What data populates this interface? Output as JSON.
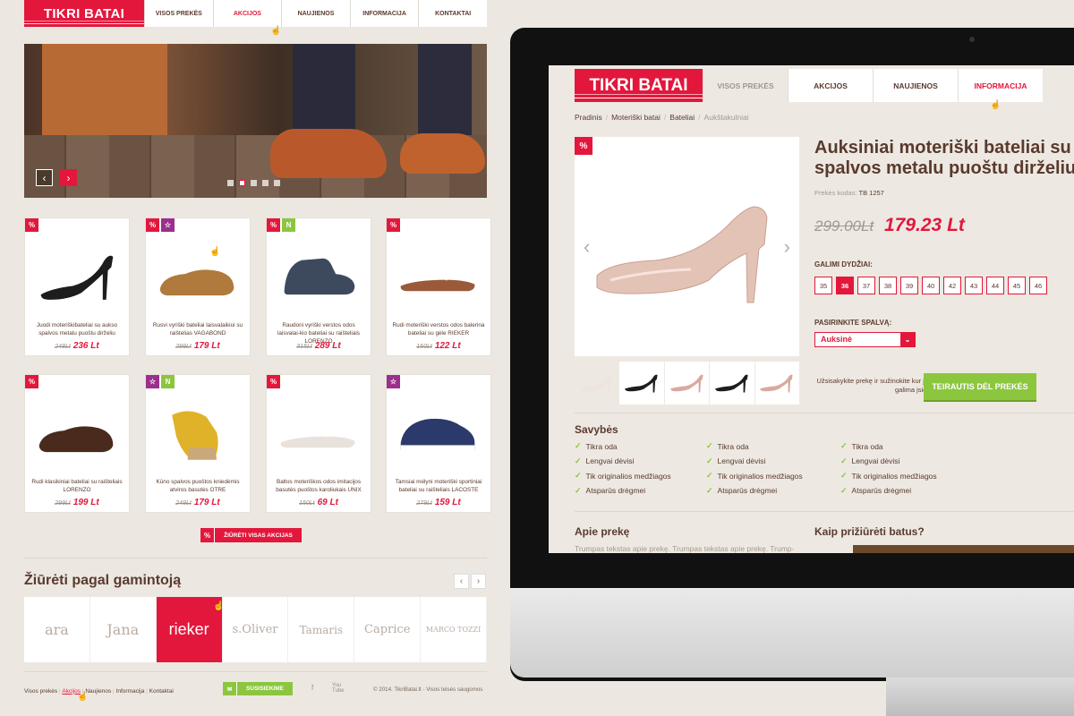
{
  "left": {
    "logo": "TIKRI BATAI",
    "nav": [
      "VISOS PREKĖS",
      "AKCIJOS",
      "NAUJIENOS",
      "INFORMACIJA",
      "KONTAKTAI"
    ],
    "nav_active": 1,
    "products": [
      {
        "badges": [
          "%"
        ],
        "name": "Juodi moteriškibateliai su aukso spalvos metalu puoštu dirželiu",
        "old": "248Lt",
        "new": "236 Lt",
        "color": "#1d1d1d",
        "kind": "heel"
      },
      {
        "badges": [
          "%",
          "☆"
        ],
        "name": "Rusvi vyriški bateliai laisvalaikiui su raištelias VAGABOND",
        "old": "299Lt",
        "new": "179 Lt",
        "color": "#b07a3c",
        "kind": "flat"
      },
      {
        "badges": [
          "%",
          "N"
        ],
        "name": "Raudoni vyriški verstos odos laisvalai-kio bateliai su raišteliais LORENZO",
        "old": "315Lt",
        "new": "289 Lt",
        "color": "#3d4a5e",
        "kind": "boot"
      },
      {
        "badges": [
          "%"
        ],
        "name": "Rudi moteriški verstos odos balerina bateliai su gėle RIEKER",
        "old": "150Lt",
        "new": "122 Lt",
        "color": "#9a5a3a",
        "kind": "sandal"
      },
      {
        "badges": [
          "%"
        ],
        "name": "Rudi klasikiniai bateliai su raišteliais LORENZO",
        "old": "299Lt",
        "new": "199 Lt",
        "color": "#4a2a1c",
        "kind": "flat"
      },
      {
        "badges": [
          "☆",
          "N"
        ],
        "name": "Kūno spalvos puoštos kniedėmis atviros basutės OTRE",
        "old": "249Lt",
        "new": "179 Lt",
        "color": "#e0b22a",
        "kind": "wedge"
      },
      {
        "badges": [
          "%"
        ],
        "name": "Baltos moteriškos odos imitacijos basutės puoštos karoliukais UNIX",
        "old": "150Lt",
        "new": "69 Lt",
        "color": "#e9e2dc",
        "kind": "sandal"
      },
      {
        "badges": [
          "☆"
        ],
        "name": "Tamsiai mėlyni moteriški sportiniai bateliai su raišteliais LACOSTE",
        "old": "279Lt",
        "new": "159 Lt",
        "color": "#2b3a6a",
        "kind": "sneaker"
      }
    ],
    "see_all": "ŽIŪRĖTI VISAS AKCIJAS",
    "brands_title": "Žiūrėti pagal gamintoją",
    "brands": [
      "ara",
      "Jana",
      "rieker",
      "s.Oliver",
      "Tamaris",
      "Caprice",
      "MARCO TOZZI"
    ],
    "brand_active": 2,
    "footer_links": [
      "Visos prekės",
      "Akcijos",
      "Naujienos",
      "Informacija",
      "Kontaktai"
    ],
    "contact": "SUSISIEKIME",
    "social": [
      "f",
      "You Tube"
    ],
    "copyright": "© 2014. TikriBatai.lt - Visos teisės saugomos"
  },
  "screen": {
    "logo": "TIKRI BATAI",
    "nav": [
      "VISOS PREKĖS",
      "AKCIJOS",
      "NAUJIENOS",
      "INFORMACIJA"
    ],
    "nav_active": 3,
    "breadcrumbs": [
      "Pradinis",
      "Moteriški batai",
      "Bateliai",
      "Aukštakulniai"
    ],
    "title_line1": "Auksiniai moteriški bateliai su",
    "title_line2": "spalvos metalu puoštu dirželiu",
    "code_label": "Prekės kodas:",
    "code": "TB 1257",
    "old_price": "299.00Lt",
    "new_price": "179.23 Lt",
    "sizes_label": "GALIMI DYDŽIAI:",
    "sizes": [
      "35",
      "36",
      "37",
      "38",
      "39",
      "40",
      "42",
      "43",
      "44",
      "45",
      "46"
    ],
    "size_active": 1,
    "color_label": "PASIRINKITE SPALVĄ:",
    "color_value": "Auksinė",
    "reserve_text": "Užsisakykite prekę ir sužinokite kur ją ją galima įsigyti:",
    "ask_button": "TEIRAUTIS DĖL PREKĖS",
    "features_title": "Savybės",
    "features": [
      "Tikra oda",
      "Lengvai dėvisi",
      "Tik originalios medžiagos",
      "Atsparūs drėgmei"
    ],
    "about_title": "Apie prekę",
    "about_text": "Trumpas tekstas apie prekę. Trumpas tekstas apie prekę. Trump-",
    "care_title": "Kaip prižiūrėti batus?",
    "thumb_colors": [
      "#f0e2dc",
      "#1d1d1d",
      "#d9a9a0",
      "#1d1d1d",
      "#d9a9a0"
    ]
  },
  "colors": {
    "accent": "#e3173c",
    "green": "#8cc63e",
    "purple": "#9c2f8e",
    "text": "#5a3a2e"
  }
}
